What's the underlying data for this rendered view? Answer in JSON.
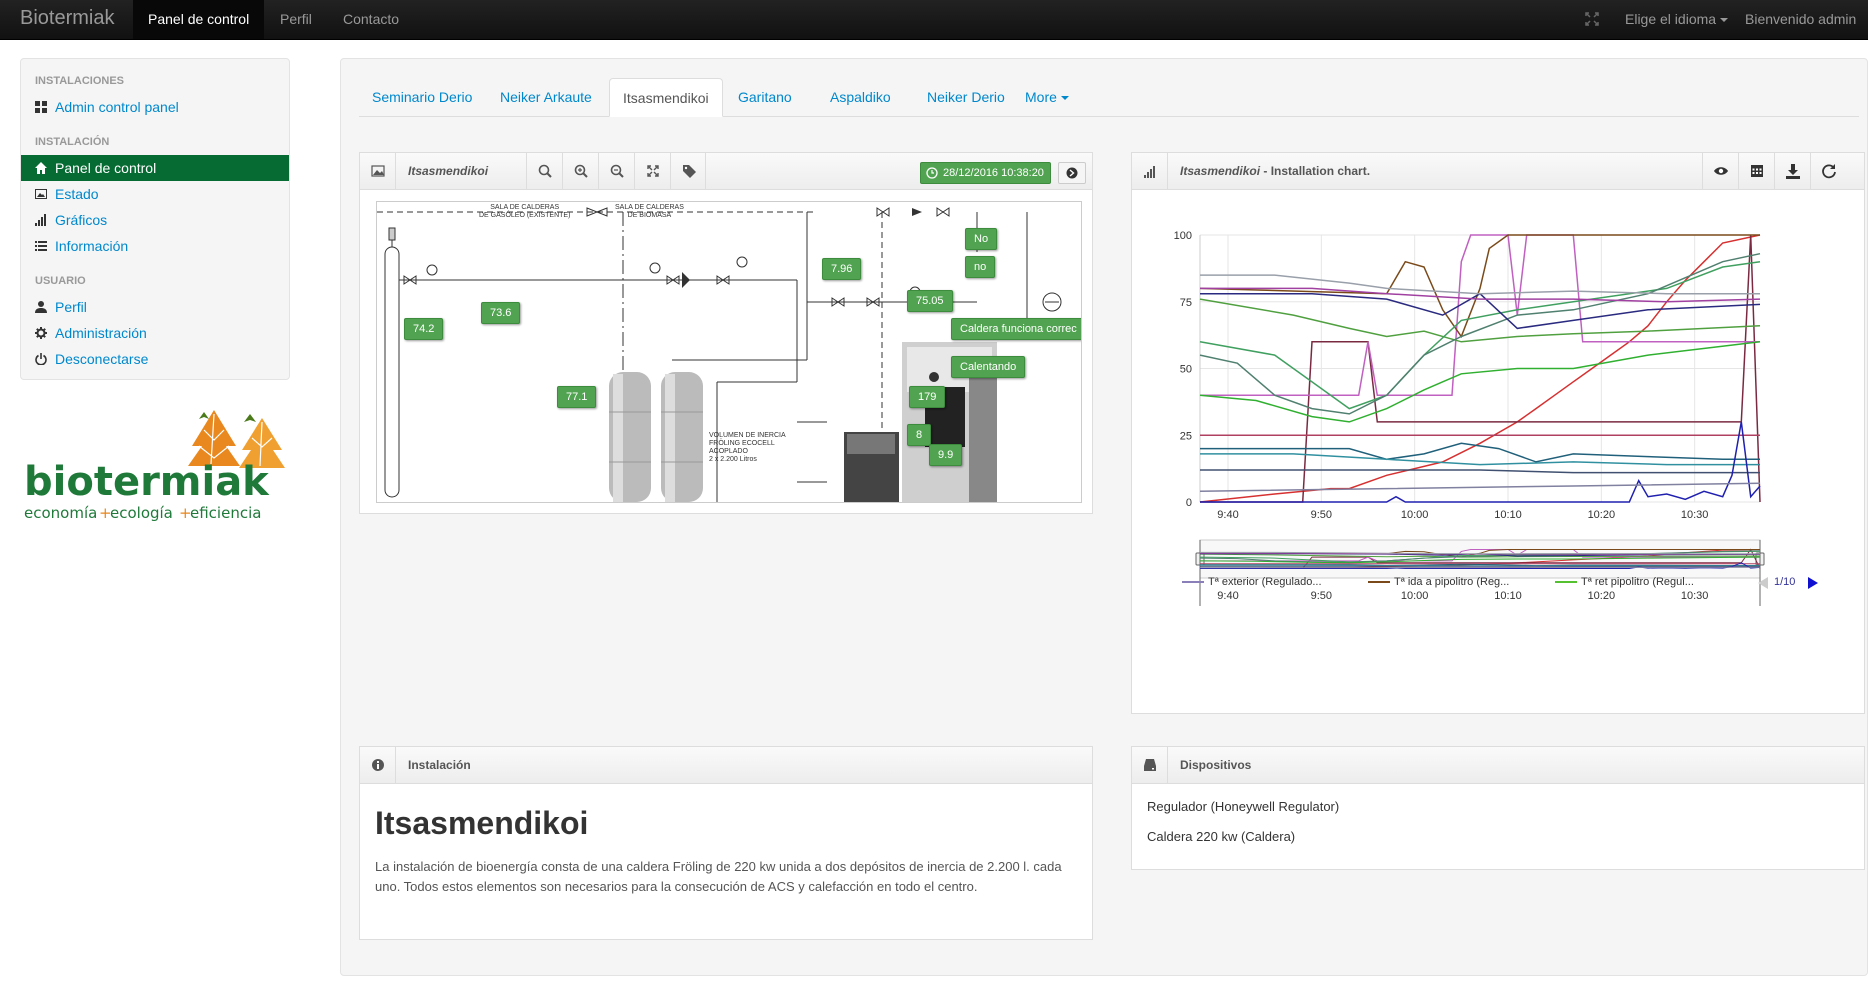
{
  "navbar": {
    "brand": "Biotermiak",
    "items": [
      {
        "label": "Panel de control",
        "active": true
      },
      {
        "label": "Perfil",
        "active": false
      },
      {
        "label": "Contacto",
        "active": false
      }
    ],
    "language": "Elige el idioma",
    "welcome": "Bienvenido admin"
  },
  "sidebar": {
    "sections": [
      {
        "header": "INSTALACIONES",
        "items": [
          {
            "label": "Admin control panel",
            "icon": "grid-icon"
          }
        ]
      },
      {
        "header": "INSTALACIÓN",
        "items": [
          {
            "label": "Panel de control",
            "icon": "home-icon",
            "active": true
          },
          {
            "label": "Estado",
            "icon": "image-icon"
          },
          {
            "label": "Gráficos",
            "icon": "signal-icon"
          },
          {
            "label": "Información",
            "icon": "list-icon"
          }
        ]
      },
      {
        "header": "USUARIO",
        "items": [
          {
            "label": "Perfil",
            "icon": "user-icon"
          },
          {
            "label": "Administración",
            "icon": "gear-icon"
          },
          {
            "label": "Desconectarse",
            "icon": "power-icon"
          }
        ]
      }
    ],
    "logo": {
      "name": "biotermiak",
      "tagline_1": "economía",
      "tagline_2": "ecología",
      "tagline_3": "eficiencia",
      "plus": "+"
    }
  },
  "tabs": [
    {
      "label": "Seminario Derio"
    },
    {
      "label": "Neiker Arkaute"
    },
    {
      "label": "Itsasmendikoi",
      "active": true
    },
    {
      "label": "Garitano"
    },
    {
      "label": "Aspaldiko"
    },
    {
      "label": "Neiker Derio"
    },
    {
      "label": "More"
    }
  ],
  "diagram_panel": {
    "title": "Itsasmendikoi",
    "timestamp": "28/12/2016 10:38:20",
    "labels": {
      "sala_gasoleo_1": "SALA DE CALDERAS",
      "sala_gasoleo_2": "DE GASÓLEO (Existente)",
      "sala_biomasa_1": "SALA DE CALDERAS",
      "sala_biomasa_2": "DE BIOMASA",
      "volumen_1": "VOLUMEN DE INERCIA",
      "volumen_2": "FRÖLING ECOCELL",
      "volumen_3": "ACOPLADO",
      "volumen_4": "2 x 2.200 Litros"
    },
    "readings": [
      "74.2",
      "73.6",
      "77.1",
      "7.96",
      "75.05",
      "No",
      "no",
      "Caldera funciona correc",
      "Calentando",
      "179",
      "8",
      "9.9"
    ]
  },
  "chart_panel": {
    "title_name": "Itsasmendikoi",
    "title_suffix": " - Installation chart.",
    "legend_page": "1/10",
    "legend": [
      {
        "name": "Tª exterior (Regulado...",
        "color": "#8a7fb8"
      },
      {
        "name": "Tª ida a pipolitro (Reg...",
        "color": "#7a4a1a"
      },
      {
        "name": "Tª ret pipolitro (Regul...",
        "color": "#55c030"
      }
    ]
  },
  "chart_data": {
    "type": "line",
    "x_ticks": [
      "9:40",
      "9:50",
      "10:00",
      "10:10",
      "10:20",
      "10:30"
    ],
    "xlim": [
      "9:37",
      "9:98"
    ],
    "y_ticks": [
      0,
      25,
      50,
      75,
      100
    ],
    "ylim": [
      0,
      100
    ],
    "grid": true,
    "legend_position": "bottom",
    "series": [
      {
        "color": "#d63030",
        "points": [
          [
            0,
            0
          ],
          [
            8,
            3
          ],
          [
            14,
            5
          ],
          [
            16,
            5
          ],
          [
            20,
            10
          ],
          [
            26,
            15
          ],
          [
            30,
            22
          ],
          [
            34,
            30
          ],
          [
            36,
            35
          ],
          [
            38,
            40
          ],
          [
            40,
            45
          ],
          [
            42,
            50
          ],
          [
            44,
            55
          ],
          [
            46,
            60
          ],
          [
            48,
            66
          ],
          [
            50,
            75
          ],
          [
            52,
            83
          ],
          [
            54,
            90
          ],
          [
            56,
            97
          ],
          [
            60,
            100
          ]
        ]
      },
      {
        "color": "#7a2a40",
        "points": [
          [
            0,
            0
          ],
          [
            11,
            0
          ],
          [
            12,
            60
          ],
          [
            18,
            60
          ],
          [
            19,
            30
          ],
          [
            58,
            30
          ],
          [
            59,
            100
          ],
          [
            60,
            0
          ]
        ]
      },
      {
        "color": "#c060c0",
        "points": [
          [
            0,
            40
          ],
          [
            17,
            40
          ],
          [
            18,
            60
          ],
          [
            19,
            40
          ],
          [
            27,
            40
          ],
          [
            28,
            90
          ],
          [
            29,
            100
          ],
          [
            33,
            100
          ],
          [
            34,
            70
          ],
          [
            35,
            100
          ],
          [
            40,
            100
          ],
          [
            41,
            60
          ],
          [
            48,
            60
          ],
          [
            60,
            60
          ]
        ]
      },
      {
        "color": "#7a4a1a",
        "points": [
          [
            0,
            80
          ],
          [
            20,
            78
          ],
          [
            22,
            90
          ],
          [
            24,
            88
          ],
          [
            26,
            72
          ],
          [
            28,
            62
          ],
          [
            30,
            80
          ],
          [
            31,
            95
          ],
          [
            33,
            100
          ],
          [
            40,
            100
          ],
          [
            48,
            100
          ],
          [
            60,
            100
          ]
        ]
      },
      {
        "color": "#50a040",
        "points": [
          [
            0,
            76
          ],
          [
            10,
            70
          ],
          [
            16,
            65
          ],
          [
            20,
            62
          ],
          [
            24,
            64
          ],
          [
            28,
            60
          ],
          [
            34,
            62
          ],
          [
            40,
            63
          ],
          [
            48,
            64
          ],
          [
            60,
            66
          ]
        ]
      },
      {
        "color": "#40a060",
        "points": [
          [
            0,
            60
          ],
          [
            8,
            55
          ],
          [
            16,
            35
          ],
          [
            20,
            40
          ],
          [
            24,
            55
          ],
          [
            28,
            68
          ],
          [
            34,
            72
          ],
          [
            40,
            75
          ],
          [
            50,
            80
          ],
          [
            56,
            88
          ],
          [
            60,
            90
          ]
        ]
      },
      {
        "color": "#508070",
        "points": [
          [
            0,
            55
          ],
          [
            4,
            52
          ],
          [
            8,
            40
          ],
          [
            12,
            35
          ],
          [
            16,
            33
          ],
          [
            20,
            40
          ],
          [
            24,
            55
          ],
          [
            28,
            62
          ],
          [
            34,
            70
          ],
          [
            40,
            72
          ],
          [
            48,
            78
          ],
          [
            56,
            90
          ],
          [
            60,
            93
          ]
        ]
      },
      {
        "color": "#30b030",
        "points": [
          [
            0,
            40
          ],
          [
            6,
            38
          ],
          [
            12,
            32
          ],
          [
            16,
            30
          ],
          [
            20,
            35
          ],
          [
            24,
            42
          ],
          [
            28,
            48
          ],
          [
            34,
            50
          ],
          [
            40,
            50
          ],
          [
            48,
            55
          ],
          [
            60,
            60
          ]
        ]
      },
      {
        "color": "#2a2a80",
        "points": [
          [
            0,
            78
          ],
          [
            12,
            78
          ],
          [
            20,
            76
          ],
          [
            26,
            70
          ],
          [
            30,
            78
          ],
          [
            34,
            65
          ],
          [
            40,
            68
          ],
          [
            48,
            72
          ],
          [
            60,
            74
          ]
        ]
      },
      {
        "color": "#a040a0",
        "points": [
          [
            0,
            80
          ],
          [
            12,
            80
          ],
          [
            20,
            78
          ],
          [
            30,
            76
          ],
          [
            40,
            76
          ],
          [
            50,
            75
          ],
          [
            60,
            76
          ]
        ]
      },
      {
        "color": "#9aa0aa",
        "points": [
          [
            0,
            85
          ],
          [
            8,
            85
          ],
          [
            16,
            82
          ],
          [
            20,
            80
          ],
          [
            30,
            78
          ],
          [
            40,
            79
          ],
          [
            50,
            78
          ],
          [
            60,
            78
          ]
        ]
      },
      {
        "color": "#b04060",
        "points": [
          [
            0,
            25
          ],
          [
            10,
            25
          ],
          [
            20,
            25
          ],
          [
            30,
            25
          ],
          [
            40,
            25
          ],
          [
            50,
            25
          ],
          [
            60,
            25
          ]
        ]
      },
      {
        "color": "#20607a",
        "points": [
          [
            0,
            20
          ],
          [
            8,
            20
          ],
          [
            16,
            20
          ],
          [
            20,
            16
          ],
          [
            24,
            18
          ],
          [
            28,
            22
          ],
          [
            32,
            20
          ],
          [
            36,
            15
          ],
          [
            40,
            18
          ],
          [
            48,
            17
          ],
          [
            56,
            16
          ],
          [
            60,
            16
          ]
        ]
      },
      {
        "color": "#3090a0",
        "points": [
          [
            0,
            18
          ],
          [
            10,
            18
          ],
          [
            20,
            16
          ],
          [
            30,
            14
          ],
          [
            40,
            15
          ],
          [
            50,
            14
          ],
          [
            60,
            14
          ]
        ]
      },
      {
        "color": "#405070",
        "points": [
          [
            0,
            12
          ],
          [
            10,
            12
          ],
          [
            20,
            12
          ],
          [
            30,
            12
          ],
          [
            40,
            11
          ],
          [
            50,
            11
          ],
          [
            60,
            11
          ]
        ]
      },
      {
        "color": "#2020b0",
        "points": [
          [
            0,
            0
          ],
          [
            20,
            0
          ],
          [
            21,
            2
          ],
          [
            22,
            0
          ],
          [
            46,
            0
          ],
          [
            47,
            8
          ],
          [
            48,
            2
          ],
          [
            50,
            3
          ],
          [
            52,
            1
          ],
          [
            54,
            4
          ],
          [
            56,
            2
          ],
          [
            57,
            10
          ],
          [
            58,
            30
          ],
          [
            59,
            2
          ],
          [
            60,
            6
          ]
        ]
      },
      {
        "color": "#8080a0",
        "points": [
          [
            0,
            4
          ],
          [
            20,
            5
          ],
          [
            40,
            6
          ],
          [
            60,
            7
          ]
        ]
      }
    ]
  }
}
